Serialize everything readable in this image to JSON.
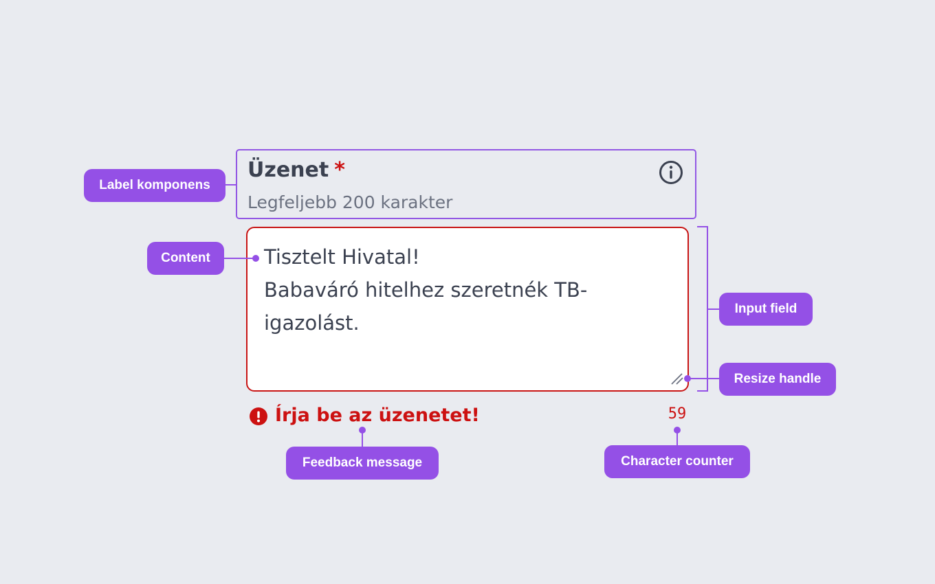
{
  "field": {
    "label": "Üzenet",
    "required_marker": "*",
    "hint": "Legfeljebb 200 karakter",
    "content_lines": [
      "Tisztelt Hivatal!",
      "Babaváró hitelhez szeretnék TB-",
      "igazolást."
    ],
    "error_message": "Írja be az üzenetet!",
    "character_count": "59"
  },
  "callouts": {
    "label_component": "Label komponens",
    "content": "Content",
    "input_field": "Input field",
    "resize_handle": "Resize handle",
    "feedback_message": "Feedback message",
    "character_counter": "Character counter"
  },
  "colors": {
    "accent": "#9450e6",
    "error": "#cc1111",
    "text": "#3b4150",
    "hint": "#6b7180",
    "background": "#e9ebf0"
  },
  "icons": [
    "info-icon",
    "resize-handle-icon",
    "error-icon"
  ]
}
